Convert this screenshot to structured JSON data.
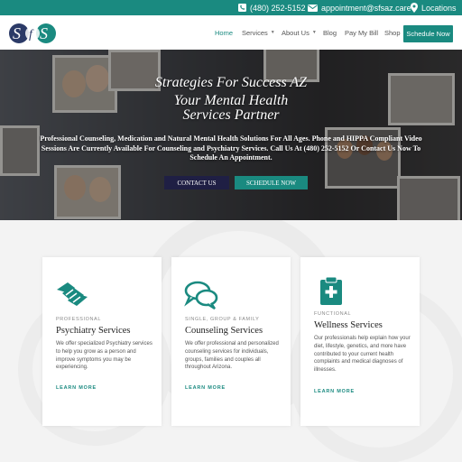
{
  "topbar": {
    "phone": "(480) 252-5152",
    "email": "appointment@sfsaz.care",
    "location": "Locations"
  },
  "header": {
    "logo_text": "SfS",
    "nav": [
      {
        "label": "Home",
        "active": true
      },
      {
        "label": "Services",
        "has_dropdown": true
      },
      {
        "label": "About Us",
        "has_dropdown": true
      },
      {
        "label": "Blog"
      },
      {
        "label": "Pay My Bill"
      },
      {
        "label": "Shop"
      }
    ],
    "cta_label": "Schedule Now"
  },
  "hero": {
    "title_line1": "Strategies For Success AZ",
    "title_line2": "Your Mental Health",
    "title_line3": "Services Partner",
    "description": "Professional Counseling, Medication and Natural Mental Health Solutions For All Ages. Phone and HIPPA Compliant Video Sessions Are Currently Available For Counseling and Psychiatry Services. Call Us At (480) 252-5152 Or Contact Us Now To Schedule An Appointment.",
    "contact_button": "CONTACT US",
    "schedule_button": "SCHEDULE NOW"
  },
  "cards": [
    {
      "overline": "PROFESSIONAL",
      "title": "Psychiatry Services",
      "text": "We offer specialized Psychiatry services to help you grow as a person and improve symptoms you may be experiencing.",
      "link": "LEARN MORE",
      "icon": "handshake-icon"
    },
    {
      "overline": "SINGLE, GROUP & FAMILY",
      "title": "Counseling Services",
      "text": "We offer professional and personalized counseling services for individuals, groups, families and couples all throughout Arizona.",
      "link": "LEARN MORE",
      "icon": "chat-bubbles-icon"
    },
    {
      "overline": "FUNCTIONAL",
      "title": "Wellness Services",
      "text": "Our professionals help explain how your diet, lifestyle, genetics, and more have contributed to your current health complaints and medical diagnoses of illnesses.",
      "link": "LEARN MORE",
      "icon": "medical-clipboard-icon"
    }
  ],
  "colors": {
    "brand_teal": "#1a8a80",
    "navy": "#1f1f44",
    "logo_navy": "#2b3a67"
  }
}
